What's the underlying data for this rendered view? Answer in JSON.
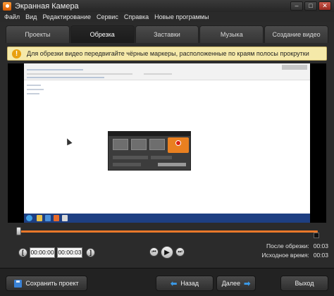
{
  "window": {
    "title": "Экранная Камера",
    "minimize": "–",
    "maximize": "□",
    "close": "✕"
  },
  "menu": [
    "Файл",
    "Вид",
    "Редактирование",
    "Сервис",
    "Справка",
    "Новые программы"
  ],
  "tabs": [
    {
      "label": "Проекты",
      "active": false
    },
    {
      "label": "Обрезка",
      "active": true
    },
    {
      "label": "Заставки",
      "active": false
    },
    {
      "label": "Музыка",
      "active": false
    },
    {
      "label": "Создание видео",
      "active": false
    }
  ],
  "hint": {
    "icon": "!",
    "text": "Для обрезки видео передвигайте чёрные маркеры, расположенные по краям полосы прокрутки"
  },
  "trim": {
    "start": "00:00:00",
    "end": "00:00:03",
    "left_marker": "[",
    "right_marker": "]"
  },
  "player": {
    "prev": "⏮",
    "play": "▶",
    "next": "⏭"
  },
  "info": {
    "after_trim_label": "После обрезки:",
    "after_trim_value": "00:03",
    "source_label": "Исходное время:",
    "source_value": "00:03"
  },
  "footer": {
    "save_label": "Сохранить проект",
    "back_label": "Назад",
    "next_label": "Далее",
    "exit_label": "Выход"
  },
  "colors": {
    "accent": "#e8772a",
    "hint_bg": "#f5e9a9",
    "arrow": "#3a9ae8"
  },
  "icons": {
    "save": "floppy-disk-icon",
    "back": "arrow-left-icon",
    "next": "arrow-right-icon"
  }
}
